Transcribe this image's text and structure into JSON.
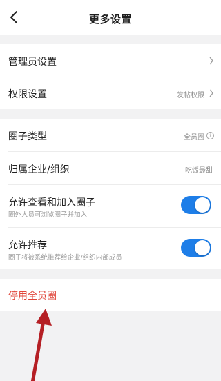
{
  "header": {
    "title": "更多设置",
    "back_icon": "chevron-left-icon"
  },
  "section_admin": {
    "admin_settings_label": "管理员设置",
    "permission_label": "权限设置",
    "permission_value": "发帖权限"
  },
  "section_circle": {
    "circle_type_label": "圈子类型",
    "circle_type_value": "全员圈",
    "affiliation_label": "归属企业/组织",
    "affiliation_value": "吃饭最甜",
    "allow_view_join_label": "允许查看和加入圈子",
    "allow_view_join_desc": "圈外人员可浏览圈子并加入",
    "allow_view_join_enabled": true,
    "allow_recommend_label": "允许推荐",
    "allow_recommend_desc": "圈子将被系统推荐给企业/组织内部成员",
    "allow_recommend_enabled": true
  },
  "danger": {
    "disable_label": "停用全员圈"
  },
  "colors": {
    "accent": "#1e7ee8",
    "danger": "#e0453a",
    "annotation_arrow": "#b51f24"
  }
}
